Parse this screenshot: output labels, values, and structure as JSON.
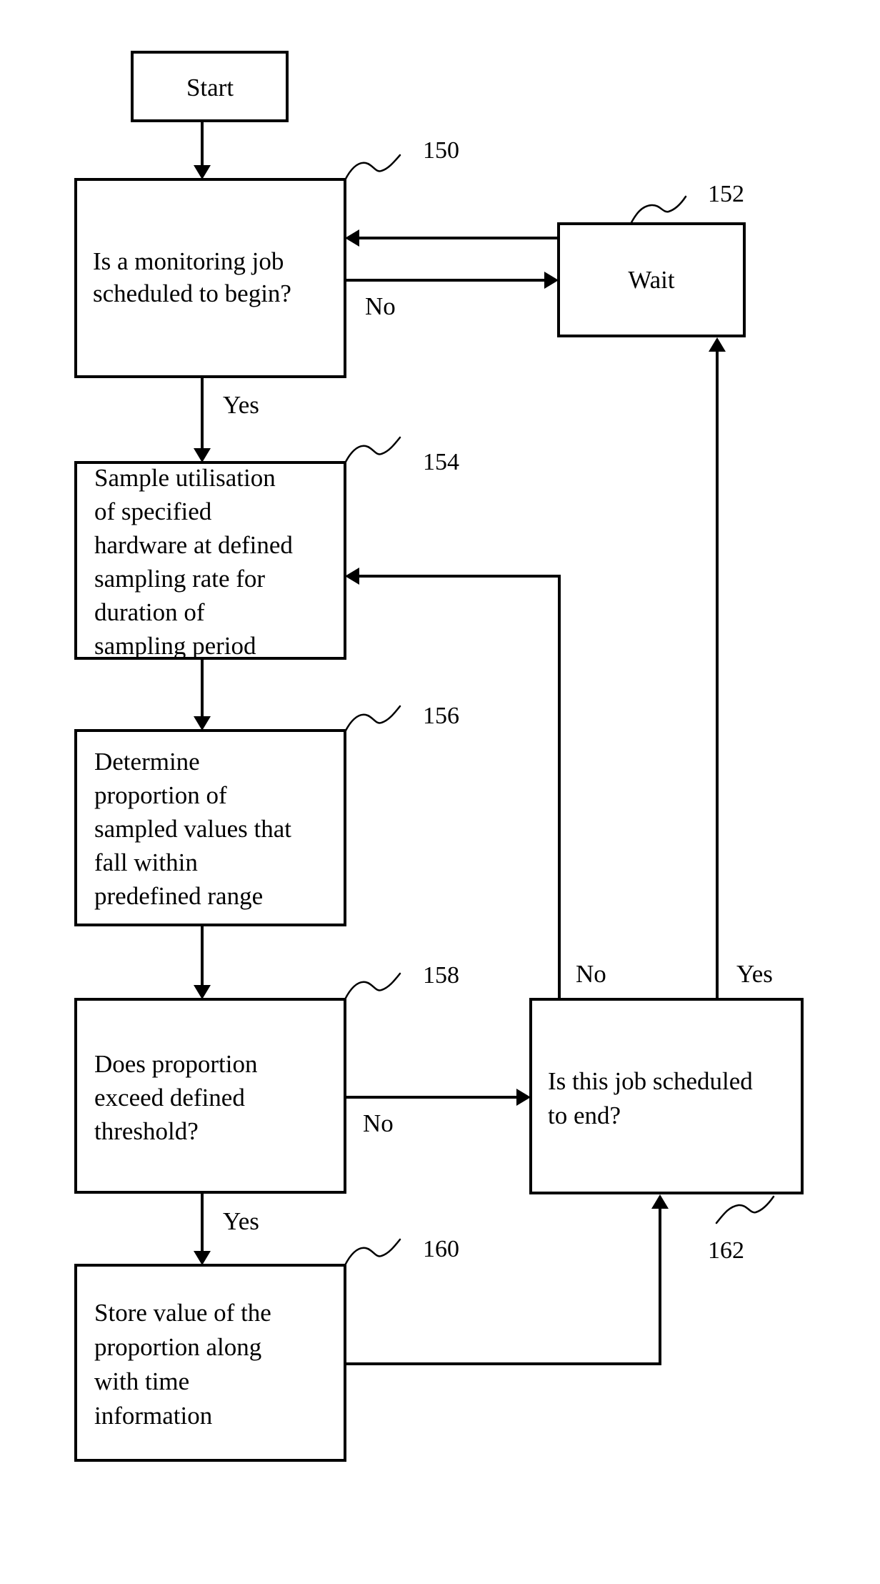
{
  "diagram": {
    "type": "flowchart",
    "nodes": {
      "start": {
        "label": "Start"
      },
      "n150": {
        "ref": "150",
        "lines": [
          "Is a monitoring job",
          "scheduled to begin?"
        ]
      },
      "n152": {
        "ref": "152",
        "label": "Wait"
      },
      "n154": {
        "ref": "154",
        "lines": [
          "Sample utilisation",
          "of specified",
          "hardware at defined",
          "sampling rate for",
          "duration of",
          "sampling period"
        ]
      },
      "n156": {
        "ref": "156",
        "lines": [
          "Determine",
          "proportion of",
          "sampled values that",
          "fall within",
          "predefined range"
        ]
      },
      "n158": {
        "ref": "158",
        "lines": [
          "Does proportion",
          "exceed defined",
          "threshold?"
        ]
      },
      "n160": {
        "ref": "160",
        "lines": [
          "Store value of the",
          "proportion along",
          "with time",
          "information"
        ]
      },
      "n162": {
        "ref": "162",
        "lines": [
          "Is this job scheduled",
          "to end?"
        ]
      }
    },
    "edges": [
      {
        "from": "start",
        "to": "n150",
        "label": ""
      },
      {
        "from": "n150",
        "to": "n152",
        "label": "No"
      },
      {
        "from": "n152",
        "to": "n150",
        "label": ""
      },
      {
        "from": "n150",
        "to": "n154",
        "label": "Yes"
      },
      {
        "from": "n154",
        "to": "n156",
        "label": ""
      },
      {
        "from": "n156",
        "to": "n158",
        "label": ""
      },
      {
        "from": "n158",
        "to": "n162",
        "label": "No"
      },
      {
        "from": "n158",
        "to": "n160",
        "label": "Yes"
      },
      {
        "from": "n160",
        "to": "n162",
        "label": ""
      },
      {
        "from": "n162",
        "to": "n154",
        "label": "No"
      },
      {
        "from": "n162",
        "to": "n152",
        "label": "Yes"
      }
    ],
    "edge_labels": {
      "n150_no": "No",
      "n150_yes": "Yes",
      "n158_no": "No",
      "n158_yes": "Yes",
      "n162_no": "No",
      "n162_yes": "Yes"
    }
  }
}
